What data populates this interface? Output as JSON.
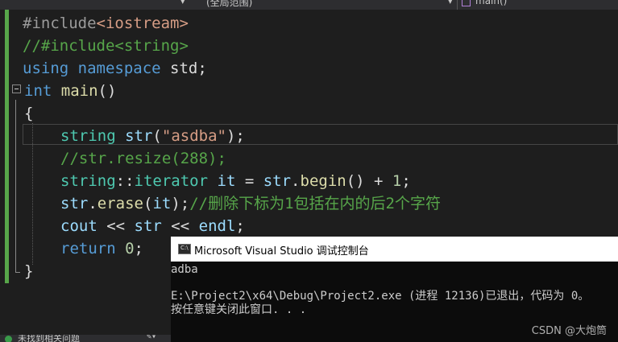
{
  "nav_bar": {
    "scope_dropdown": "(全局范围)",
    "function_dropdown": "main()"
  },
  "editor": {
    "lines": [
      {
        "preproc": "#include",
        "header": "<iostream>"
      },
      {
        "comment": "//#include<string>"
      },
      {
        "kw1": "using",
        "kw2": "namespace",
        "rest": " std;"
      },
      {
        "type": "int",
        "name": "main",
        "rest": "()"
      },
      {
        "text": "{"
      },
      {
        "type": "string",
        "var": "str",
        "open": "(",
        "str": "\"asdba\"",
        "close": ");"
      },
      {
        "comment": "//str.resize(288);"
      },
      {
        "type": "string",
        "sep": "::",
        "type2": "iterator",
        "var": "it",
        "eq": " = ",
        "obj": "str",
        "dot": ".",
        "fn": "begin",
        "rest": "() + ",
        "num": "1",
        "end": ";"
      },
      {
        "obj": "str",
        "dot": ".",
        "fn": "erase",
        "open": "(",
        "var": "it",
        "close": ");",
        "comment": "//删除下标为1包括在内的后2个字符"
      },
      {
        "kw": "cout",
        "op1": " << ",
        "var": "str",
        "op2": " << ",
        "kw2": "endl",
        "end": ";"
      },
      {
        "kw": "return",
        "num": "0",
        "end": ";"
      },
      {
        "text": "}"
      }
    ]
  },
  "status_bar": {
    "message": "未找到相关问题"
  },
  "console": {
    "icon_label": "C:\\",
    "title": "Microsoft Visual Studio 调试控制台",
    "output_line1": "adba",
    "output_line2": "E:\\Project2\\x64\\Debug\\Project2.exe (进程 12136)已退出，代码为 0。",
    "output_line3": "按任意键关闭此窗口. . ."
  },
  "watermark": "CSDN @大炮筒"
}
